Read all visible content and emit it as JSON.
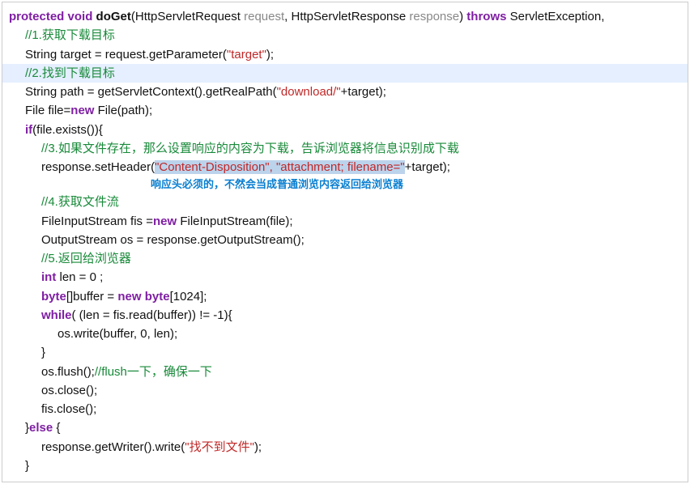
{
  "sig": {
    "protected": "protected",
    "void": "void",
    "doGet": "doGet",
    "lp": "(",
    "t1": "HttpServletRequest ",
    "p1": "request",
    "c1": ", ",
    "t2": "HttpServletResponse ",
    "p2": "response",
    "rp": ") ",
    "throws": "throws",
    "ex": " ServletException,"
  },
  "c1": "//1.获取下载目标",
  "l2a": "String target = request.getParameter(",
  "l2s": "\"target\"",
  "l2b": ");",
  "c2": "//2.找到下载目标",
  "l3a": "String path = getServletContext().getRealPath(",
  "l3s": "\"download/\"",
  "l3b": "+target);",
  "l4a": "File file=",
  "kw_new": "new",
  "l4b": " File(path);",
  "kw_if": "if",
  "l5a": "(file.exists()){",
  "c3": "//3.如果文件存在，那么设置响应的内容为下载，告诉浏览器将信息识别成下载",
  "l6a": "response.setHeader(",
  "l6s1": "\"Content-Disposition\"",
  "l6c": ", ",
  "l6s2": "\"attachment; filename=\"",
  "l6b": "+target);",
  "anno": "响应头必须的，不然会当成普通浏览内容返回给浏览器",
  "c4": "//4.获取文件流",
  "l7a": "FileInputStream fis =",
  "l7b": " FileInputStream(file);",
  "l8": "OutputStream os = response.getOutputStream();",
  "c5": "//5.返回给浏览器",
  "kw_int": "int",
  "l9": " len = 0 ;",
  "kw_byte": "byte",
  "l10a": "[]buffer = ",
  "l10b": "[1024];",
  "kw_while": "while",
  "l11": "( (len = fis.read(buffer)) != -1){",
  "l12": "os.write(buffer, 0, len);",
  "rb": "}",
  "l13a": "os.flush();",
  "c6": "//flush一下，确保一下",
  "l14": "os.close();",
  "l15": "fis.close();",
  "rb2": "}",
  "kw_else": "else",
  "l16": " {",
  "l17a": "response.getWriter().write(",
  "l17s": "\"找不到文件\"",
  "l17b": ");",
  "rb3": "}"
}
